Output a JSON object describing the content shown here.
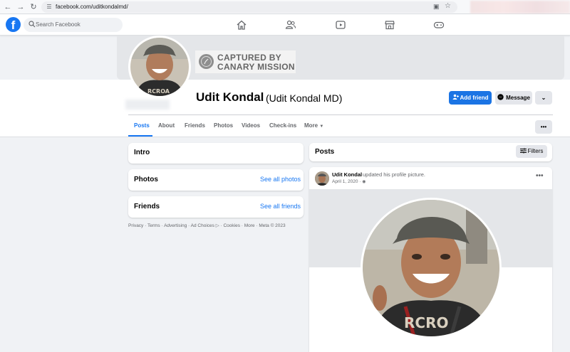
{
  "browser": {
    "url": "facebook.com/uditkondalmd/"
  },
  "nav": {
    "search_placeholder": "Search Facebook",
    "logo_letter": "f"
  },
  "watermark": {
    "line1": "CAPTURED BY",
    "line2": "CANARY MISSION"
  },
  "profile": {
    "name": "Udit Kondal",
    "alternate_name": "(Udit Kondal MD)",
    "add_friend_label": "Add friend",
    "message_label": "Message"
  },
  "tabs": {
    "posts": "Posts",
    "about": "About",
    "friends": "Friends",
    "photos": "Photos",
    "videos": "Videos",
    "checkins": "Check-ins",
    "more": "More"
  },
  "left": {
    "intro_title": "Intro",
    "photos_title": "Photos",
    "photos_link": "See all photos",
    "friends_title": "Friends",
    "friends_link": "See all friends",
    "footer": "Privacy · Terms · Advertising · Ad Choices ▷ · Cookies · More · Meta © 2023"
  },
  "posts": {
    "title": "Posts",
    "filters_label": "Filters",
    "post": {
      "author": "Udit Kondal",
      "action": "updated his profile picture.",
      "date": "April 1, 2020 · "
    }
  },
  "colors": {
    "brand": "#1877f2",
    "page_bg": "#f0f2f5"
  }
}
